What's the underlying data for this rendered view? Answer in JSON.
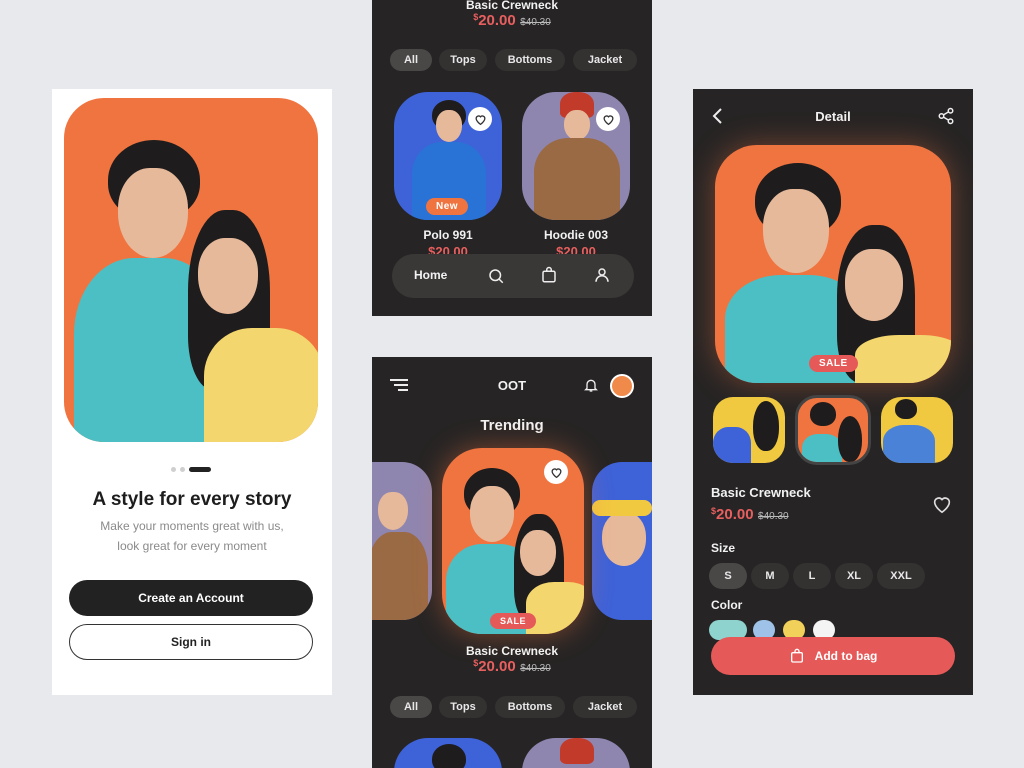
{
  "onboarding": {
    "headline": "A style for every story",
    "subtitle_line1": "Make your moments great with us,",
    "subtitle_line2": "look great for every moment",
    "create_label": "Create an Account",
    "signin_label": "Sign in"
  },
  "catalog_top": {
    "product_title": "Basic Crewneck",
    "currency": "$",
    "price": "20.00",
    "old_price": "$40.30",
    "filters": [
      "All",
      "Tops",
      "Bottoms",
      "Jacket"
    ],
    "cards": [
      {
        "name": "Polo 991",
        "price": "$20.00",
        "badge": "New"
      },
      {
        "name": "Hoodie 003",
        "price": "$20.00"
      }
    ],
    "nav_home_label": "Home"
  },
  "trending": {
    "app_title": "OOT",
    "section_title": "Trending",
    "featured_badge": "SALE",
    "featured_name": "Basic Crewneck",
    "currency": "$",
    "price": "20.00",
    "old_price": "$40.30",
    "filters": [
      "All",
      "Tops",
      "Bottoms",
      "Jacket"
    ]
  },
  "detail": {
    "header_title": "Detail",
    "badge": "SALE",
    "product_name": "Basic Crewneck",
    "currency": "$",
    "price": "20.00",
    "old_price": "$40.30",
    "size_label": "Size",
    "sizes": [
      "S",
      "M",
      "L",
      "XL",
      "XXL"
    ],
    "selected_size": "S",
    "color_label": "Color",
    "colors": [
      "#8fd3cf",
      "#9fc3e8",
      "#f2d15a",
      "#f4f4f4"
    ],
    "add_to_bag_label": "Add to bag"
  },
  "colors": {
    "accent": "#e55a58",
    "dark_bg": "#262424",
    "orange": "#f07440"
  },
  "icons": [
    "back-icon",
    "share-icon",
    "heart-icon",
    "search-icon",
    "bag-icon",
    "user-icon",
    "menu-icon",
    "bell-icon"
  ]
}
